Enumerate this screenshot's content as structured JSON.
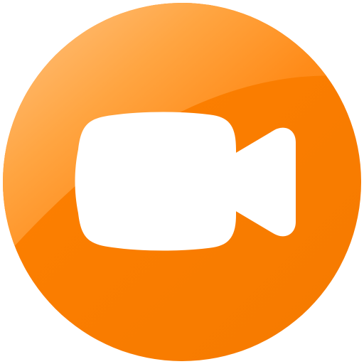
{
  "icon": {
    "name": "video-camera-icon",
    "colors": {
      "base": "#FF8000",
      "base_dark": "#F57A00",
      "gloss_light": "#FFC78A",
      "gloss_mid": "#FFA745",
      "glyph": "#FFFFFF"
    }
  }
}
